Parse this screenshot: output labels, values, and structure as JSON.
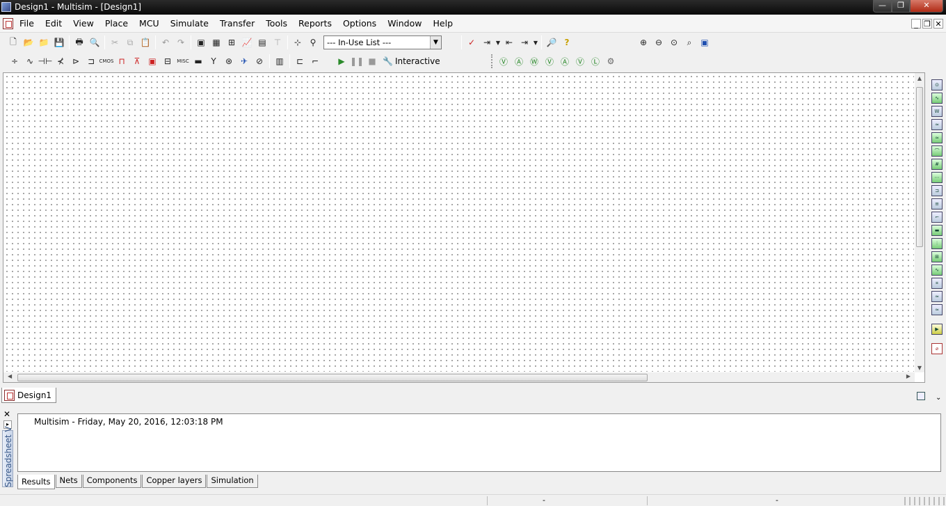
{
  "window": {
    "title": "Design1 - Multisim - [Design1]",
    "min": "—",
    "max": "❐",
    "close": "✕"
  },
  "menu": {
    "items": [
      "File",
      "Edit",
      "View",
      "Place",
      "MCU",
      "Simulate",
      "Transfer",
      "Tools",
      "Reports",
      "Options",
      "Window",
      "Help"
    ]
  },
  "mdi": {
    "min": "_",
    "restore": "❐",
    "close": "✕"
  },
  "toolbar": {
    "in_use_list": "--- In-Use List ---",
    "interactive_label": "Interactive",
    "misc_label": "MISC"
  },
  "design_tab": {
    "label": "Design1"
  },
  "results": {
    "log_line": "Multisim  -  Friday, May 20, 2016, 12:03:18 PM",
    "side_label": "Spreadsheet V",
    "tabs": [
      "Results",
      "Nets",
      "Components",
      "Copper layers",
      "Simulation"
    ],
    "active_tab": "Results"
  },
  "status": {
    "cell1": "-",
    "cell2": "-"
  }
}
